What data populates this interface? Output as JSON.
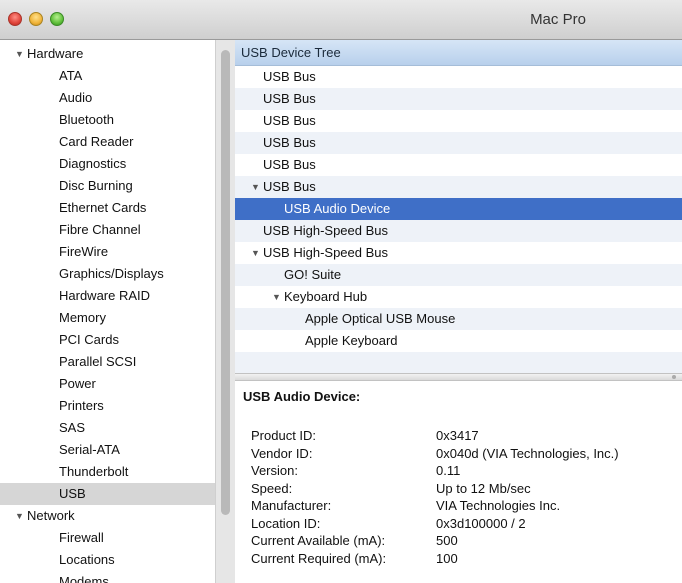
{
  "window": {
    "title": "Mac Pro"
  },
  "sidebar": {
    "groups": [
      {
        "label": "Hardware",
        "items": [
          "ATA",
          "Audio",
          "Bluetooth",
          "Card Reader",
          "Diagnostics",
          "Disc Burning",
          "Ethernet Cards",
          "Fibre Channel",
          "FireWire",
          "Graphics/Displays",
          "Hardware RAID",
          "Memory",
          "PCI Cards",
          "Parallel SCSI",
          "Power",
          "Printers",
          "SAS",
          "Serial-ATA",
          "Thunderbolt",
          "USB"
        ]
      },
      {
        "label": "Network",
        "items": [
          "Firewall",
          "Locations",
          "Modems"
        ]
      }
    ],
    "selected": "USB"
  },
  "tree": {
    "header": "USB Device Tree",
    "rows": [
      {
        "label": "USB Bus"
      },
      {
        "label": "USB Bus"
      },
      {
        "label": "USB Bus"
      },
      {
        "label": "USB Bus"
      },
      {
        "label": "USB Bus"
      },
      {
        "label": "USB Bus",
        "expanded": true
      },
      {
        "label": "USB Audio Device",
        "selected": true
      },
      {
        "label": "USB High-Speed Bus"
      },
      {
        "label": "USB High-Speed Bus",
        "expanded": true
      },
      {
        "label": "GO! Suite"
      },
      {
        "label": "Keyboard Hub",
        "expanded": true
      },
      {
        "label": "Apple Optical USB Mouse"
      },
      {
        "label": "Apple Keyboard"
      }
    ]
  },
  "detail": {
    "title": "USB Audio Device:",
    "properties": [
      {
        "key": "Product ID:",
        "value": "0x3417"
      },
      {
        "key": "Vendor ID:",
        "value": "0x040d  (VIA Technologies, Inc.)"
      },
      {
        "key": "Version:",
        "value": "0.11"
      },
      {
        "key": "Speed:",
        "value": "Up to 12 Mb/sec"
      },
      {
        "key": "Manufacturer:",
        "value": "VIA Technologies Inc."
      },
      {
        "key": "Location ID:",
        "value": "0x3d100000 / 2"
      },
      {
        "key": "Current Available (mA):",
        "value": "500"
      },
      {
        "key": "Current Required (mA):",
        "value": "100"
      }
    ]
  },
  "icons": {
    "disclosure_open": "▼",
    "window_controls": [
      "close-icon",
      "minimize-icon",
      "zoom-icon"
    ]
  },
  "colors": {
    "selection_blue": "#3f6fc7",
    "header_blue": "#c7daf1",
    "sidebar_selection": "#d6d6d6",
    "row_alt": "#eef2f8"
  }
}
